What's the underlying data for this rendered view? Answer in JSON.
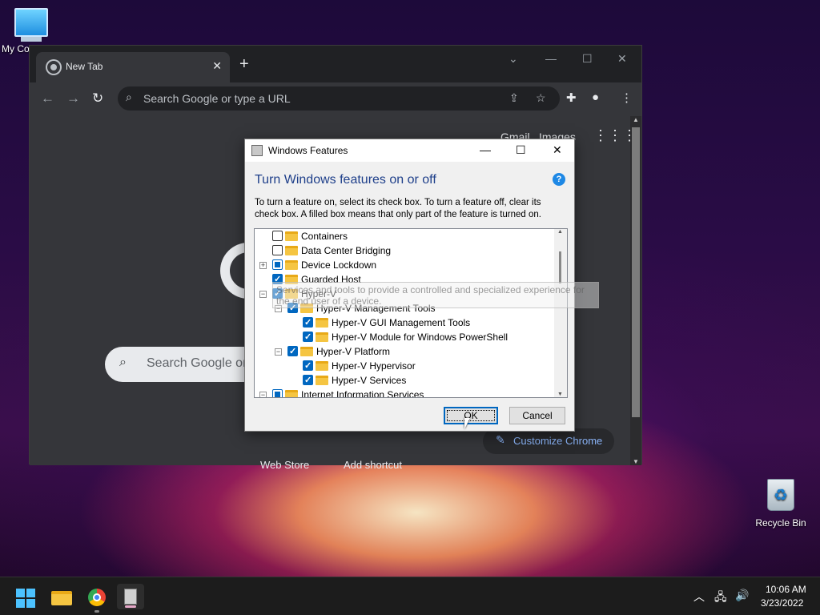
{
  "desktop": {
    "my_computer_label": "My Co",
    "recycle_bin_label": "Recycle Bin"
  },
  "chrome": {
    "tab_title": "New Tab",
    "tab_close": "✕",
    "new_tab": "+",
    "omnibox_placeholder": "Search Google or type a URL",
    "gmail": "Gmail",
    "images": "Images",
    "search_placeholder": "Search Google or",
    "shortcuts": [
      "Web Store",
      "Add shortcut"
    ],
    "customize_label": "Customize Chrome"
  },
  "dialog": {
    "title": "Windows Features",
    "heading": "Turn Windows features on or off",
    "help": "?",
    "description": "To turn a feature on, select its check box. To turn a feature off, clear its check box. A filled box means that only part of the feature is turned on.",
    "tooltip": "Services and tools to provide a controlled and specialized experience for the end user of a device.",
    "ok_label": "OK",
    "cancel_label": "Cancel",
    "features": [
      {
        "label": "Containers",
        "state": "unchecked",
        "level": 0,
        "expander": ""
      },
      {
        "label": "Data Center Bridging",
        "state": "unchecked",
        "level": 0,
        "expander": ""
      },
      {
        "label": "Device Lockdown",
        "state": "partial",
        "level": 0,
        "expander": "+"
      },
      {
        "label": "Guarded Host",
        "state": "checked",
        "level": 0,
        "expander": ""
      },
      {
        "label": "Hyper-V",
        "state": "checked",
        "level": 0,
        "expander": "−"
      },
      {
        "label": "Hyper-V Management Tools",
        "state": "checked",
        "level": 1,
        "expander": "−"
      },
      {
        "label": "Hyper-V GUI Management Tools",
        "state": "checked",
        "level": 2,
        "expander": ""
      },
      {
        "label": "Hyper-V Module for Windows PowerShell",
        "state": "checked",
        "level": 2,
        "expander": ""
      },
      {
        "label": "Hyper-V Platform",
        "state": "checked",
        "level": 1,
        "expander": "−"
      },
      {
        "label": "Hyper-V Hypervisor",
        "state": "checked",
        "level": 2,
        "expander": ""
      },
      {
        "label": "Hyper-V Services",
        "state": "checked",
        "level": 2,
        "expander": ""
      },
      {
        "label": "Internet Information Services",
        "state": "partial",
        "level": 0,
        "expander": "−"
      }
    ]
  },
  "taskbar": {
    "time": "10:06 AM",
    "date": "3/23/2022",
    "apps": [
      "start-icon",
      "file-explorer-icon",
      "chrome-icon",
      "windows-features-icon"
    ]
  }
}
